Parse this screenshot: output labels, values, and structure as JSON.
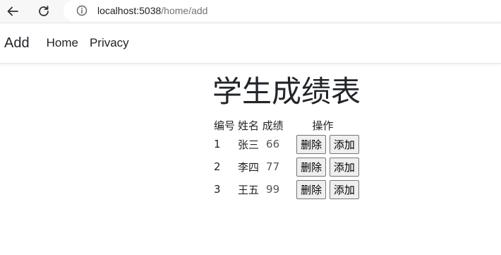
{
  "browser": {
    "url_host": "localhost:5038",
    "url_path": "/home/add"
  },
  "navbar": {
    "brand": "Add",
    "links": [
      "Home",
      "Privacy"
    ]
  },
  "main": {
    "title": "学生成绩表",
    "table": {
      "headers": [
        "编号",
        "姓名",
        "成绩",
        "操作"
      ],
      "rows": [
        {
          "id": "1",
          "name": "张三",
          "score": "66"
        },
        {
          "id": "2",
          "name": "李四",
          "score": "77"
        },
        {
          "id": "3",
          "name": "王五",
          "score": "99"
        }
      ],
      "delete_label": "删除",
      "add_label": "添加"
    }
  },
  "icons": {
    "back": "arrow-left-icon",
    "reload": "reload-icon",
    "info": "info-icon"
  }
}
